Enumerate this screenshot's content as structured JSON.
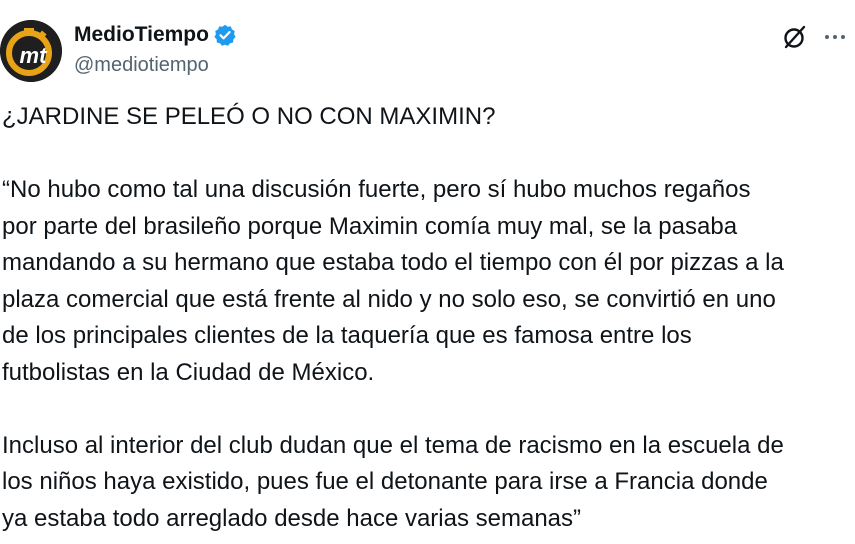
{
  "author": {
    "display_name": "MedioTiempo",
    "handle": "@mediotiempo",
    "avatar_text": "mt",
    "verified": true
  },
  "actions": {
    "grok_icon": "grok-slash-circle-icon",
    "more_icon": "more-horizontal-icon"
  },
  "tweet": {
    "headline": "¿JARDINE SE PELEÓ O NO CON MAXIMIN?",
    "paragraph1_line1": "“No hubo como tal una discusión fuerte, pero sí hubo muchos regaños",
    "paragraph1_line2": "por parte del brasileño porque Maximin comía muy mal, se la pasaba",
    "paragraph1_line3": "mandando a su hermano que estaba todo el tiempo con él por pizzas a la",
    "paragraph1_line4": "plaza comercial que está frente al nido y no solo eso, se convirtió en uno",
    "paragraph1_line5": "de los principales clientes de la taquería que es famosa entre los",
    "paragraph1_line6": "futbolistas en la Ciudad de México.",
    "paragraph2_line1": "Incluso al interior del club dudan que el tema de racismo en la escuela de",
    "paragraph2_line2": "los niños haya existido, pues fue el detonante para irse a Francia donde",
    "paragraph2_line3": "ya estaba todo arreglado desde hace varias semanas”"
  },
  "colors": {
    "text": "#0f1419",
    "secondary_text": "#536471",
    "verified_blue": "#1d9bf0",
    "avatar_bg": "#1f1f1f",
    "avatar_gold": "#e8a317"
  }
}
